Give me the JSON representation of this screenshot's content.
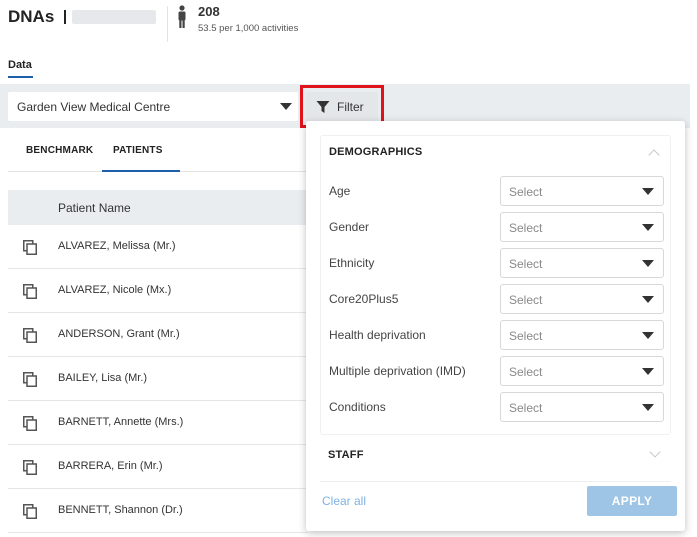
{
  "header": {
    "title": "DNAs",
    "metric_value": "208",
    "metric_sub": "53.5 per 1,000 activities",
    "tab_label": "Data"
  },
  "toolbar": {
    "practice_select": "Garden View Medical Centre",
    "filter_label": "Filter",
    "highlight_color": "#e0121b"
  },
  "subtabs": [
    "BENCHMARK",
    "PATIENTS"
  ],
  "patients": {
    "column_header": "Patient Name",
    "rows": [
      "ALVAREZ, Melissa (Mr.)",
      "ALVAREZ, Nicole (Mx.)",
      "ANDERSON, Grant (Mr.)",
      "BAILEY, Lisa (Mr.)",
      "BARNETT, Annette (Mrs.)",
      "BARRERA, Erin (Mr.)",
      "BENNETT, Shannon (Dr.)"
    ]
  },
  "filter_panel": {
    "demographics_title": "DEMOGRAPHICS",
    "fields": [
      {
        "label": "Age",
        "value": "Select"
      },
      {
        "label": "Gender",
        "value": "Select"
      },
      {
        "label": "Ethnicity",
        "value": "Select"
      },
      {
        "label": "Core20Plus5",
        "value": "Select"
      },
      {
        "label": "Health deprivation",
        "value": "Select"
      },
      {
        "label": "Multiple deprivation (IMD)",
        "value": "Select"
      },
      {
        "label": "Conditions",
        "value": "Select"
      }
    ],
    "staff_title": "STAFF",
    "clear_all": "Clear all",
    "apply": "APPLY"
  },
  "colors": {
    "accent": "#1f5ea8",
    "apply_disabled": "#9fc5e6",
    "link": "#7fb2e5"
  }
}
